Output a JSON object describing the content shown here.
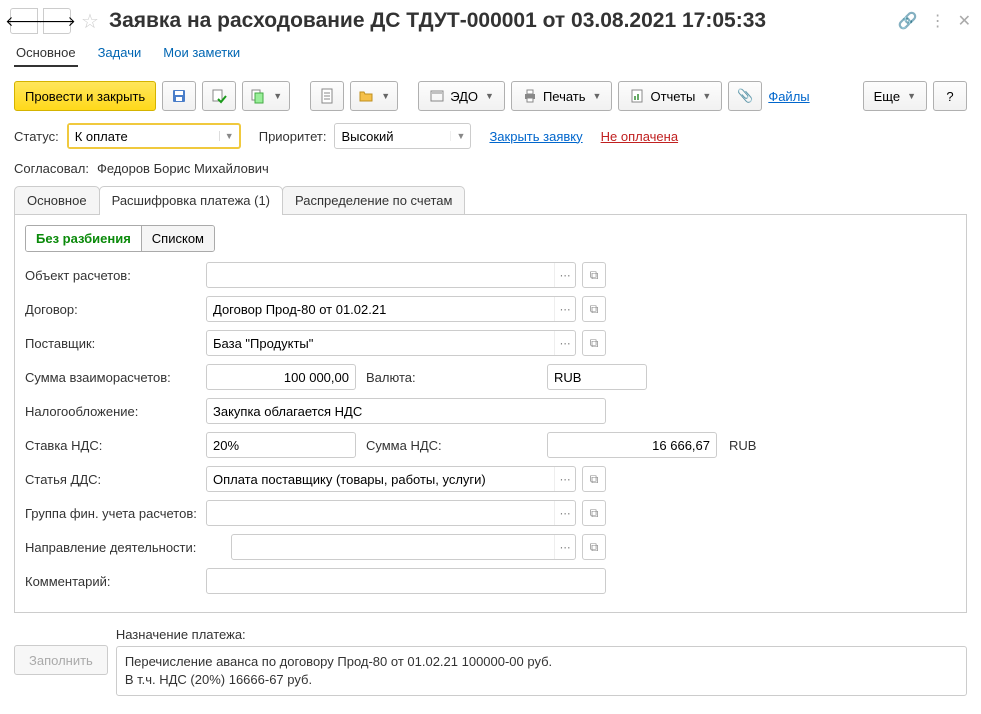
{
  "title": "Заявка на расходование ДС ТДУТ-000001 от 03.08.2021 17:05:33",
  "sections": {
    "main": "Основное",
    "tasks": "Задачи",
    "notes": "Мои заметки"
  },
  "toolbar": {
    "post_close": "Провести и закрыть",
    "edo": "ЭДО",
    "print": "Печать",
    "reports": "Отчеты",
    "files": "Файлы",
    "more": "Еще",
    "help": "?"
  },
  "status": {
    "label": "Статус:",
    "value": "К оплате",
    "priority_label": "Приоритет:",
    "priority_value": "Высокий",
    "close_link": "Закрыть заявку",
    "not_paid": "Не оплачена"
  },
  "approved": {
    "label": "Согласовал:",
    "value": "Федоров Борис Михайлович"
  },
  "tabs": {
    "main": "Основное",
    "detail": "Расшифровка платежа (1)",
    "accounts": "Распределение по счетам"
  },
  "mode": {
    "no_split": "Без разбиения",
    "list": "Списком"
  },
  "fields": {
    "object_label": "Объект расчетов:",
    "object_value": "",
    "contract_label": "Договор:",
    "contract_value": "Договор Прод-80 от 01.02.21",
    "supplier_label": "Поставщик:",
    "supplier_value": "База \"Продукты\"",
    "sum_label": "Сумма взаиморасчетов:",
    "sum_value": "100 000,00",
    "currency_label": "Валюта:",
    "currency_value": "RUB",
    "tax_label": "Налогообложение:",
    "tax_value": "Закупка облагается НДС",
    "vat_rate_label": "Ставка НДС:",
    "vat_rate_value": "20%",
    "vat_sum_label": "Сумма НДС:",
    "vat_sum_value": "16 666,67",
    "vat_sum_cur": "RUB",
    "dds_label": "Статья ДДС:",
    "dds_value": "Оплата поставщику (товары, работы, услуги)",
    "fingroup_label": "Группа фин. учета расчетов:",
    "fingroup_value": "",
    "direction_label": "Направление деятельности:",
    "direction_value": "",
    "comment_label": "Комментарий:",
    "comment_value": ""
  },
  "purpose": {
    "label": "Назначение платежа:",
    "fill": "Заполнить",
    "line1": "Перечисление аванса по договору Прод-80 от 01.02.21 100000-00 руб.",
    "line2": "В т.ч. НДС (20%) 16666-67 руб."
  }
}
